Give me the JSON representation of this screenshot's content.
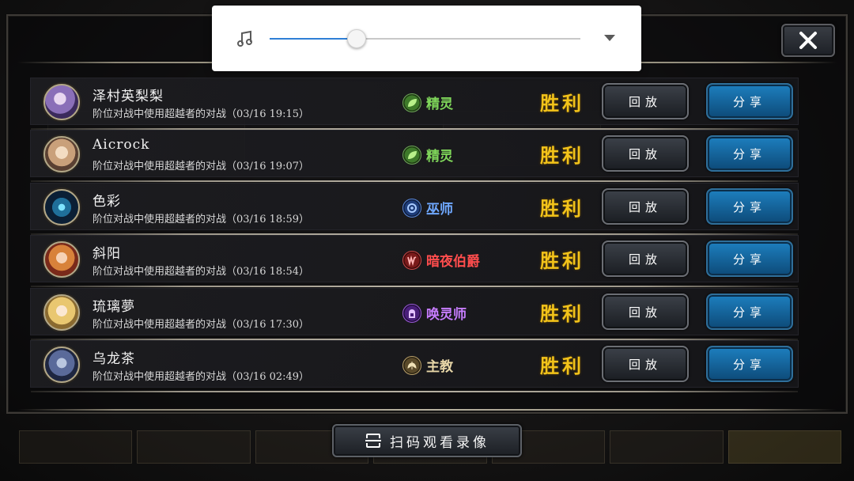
{
  "volume_popup": {
    "icon": "music-note-icon",
    "level": 0.28,
    "accent_color": "#2f7fd6",
    "expand_icon": "chevron-down-icon"
  },
  "close_button": {
    "icon": "close-icon"
  },
  "matches": [
    {
      "player": "泽村英梨梨",
      "desc": "阶位对战中使用超越者的对战（03/16 19:15）",
      "class": "精灵",
      "class_color": "#7fd65a",
      "class_icon": "leaf-icon",
      "result": "胜利",
      "replay": "回放",
      "share": "分享"
    },
    {
      "player": "Aicrock",
      "desc": "阶位对战中使用超越者的对战（03/16 19:07）",
      "class": "精灵",
      "class_color": "#7fd65a",
      "class_icon": "leaf-icon",
      "result": "胜利",
      "replay": "回放",
      "share": "分享"
    },
    {
      "player": "色彩",
      "desc": "阶位对战中使用超越者的对战（03/16 18:59）",
      "class": "巫师",
      "class_color": "#6fa8ff",
      "class_icon": "rune-icon",
      "result": "胜利",
      "replay": "回放",
      "share": "分享"
    },
    {
      "player": "斜阳",
      "desc": "阶位对战中使用超越者的对战（03/16 18:54）",
      "class": "暗夜伯爵",
      "class_color": "#ff4d4d",
      "class_icon": "fang-icon",
      "result": "胜利",
      "replay": "回放",
      "share": "分享"
    },
    {
      "player": "琉璃夢",
      "desc": "阶位对战中使用超越者的对战（03/16 17:30）",
      "class": "唤灵师",
      "class_color": "#c77dff",
      "class_icon": "tombstone-icon",
      "result": "胜利",
      "replay": "回放",
      "share": "分享"
    },
    {
      "player": "乌龙茶",
      "desc": "阶位对战中使用超越者的对战（03/16 02:49）",
      "class": "主教",
      "class_color": "#e8d7a8",
      "class_icon": "wings-icon",
      "result": "胜利",
      "replay": "回放",
      "share": "分享"
    }
  ],
  "scan_button": {
    "label": "扫码观看录像",
    "icon": "scan-icon"
  }
}
